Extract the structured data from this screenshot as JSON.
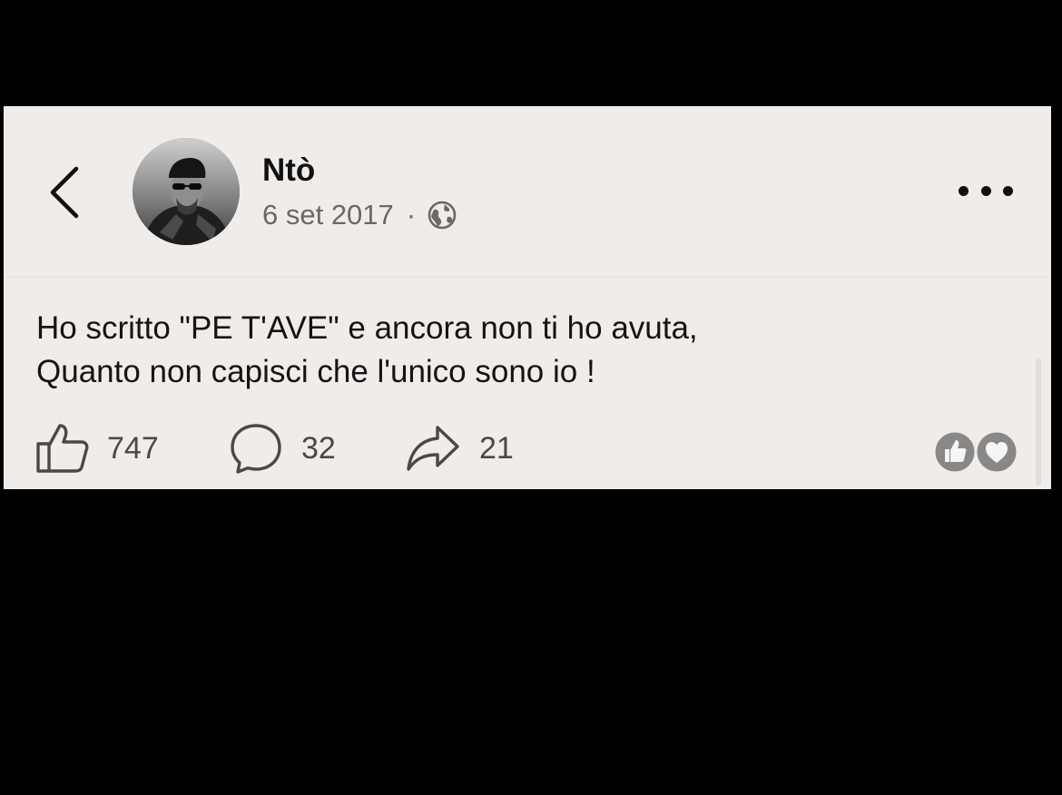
{
  "post": {
    "author": "Ntò",
    "date": "6 set 2017",
    "separator": "·",
    "visibility_icon": "globe-icon",
    "text_line1": "Ho scritto \"PE T'AVE\" e ancora non ti ho avuta,",
    "text_line2": "Quanto non capisci che l'unico sono io !"
  },
  "actions": {
    "likes": "747",
    "comments": "32",
    "shares": "21"
  },
  "reactions": [
    "like-reaction-icon",
    "love-reaction-icon"
  ],
  "colors": {
    "card_background": "#f0ecea",
    "page_background": "#000000",
    "text": "#141414",
    "muted_text": "#6a6868"
  }
}
